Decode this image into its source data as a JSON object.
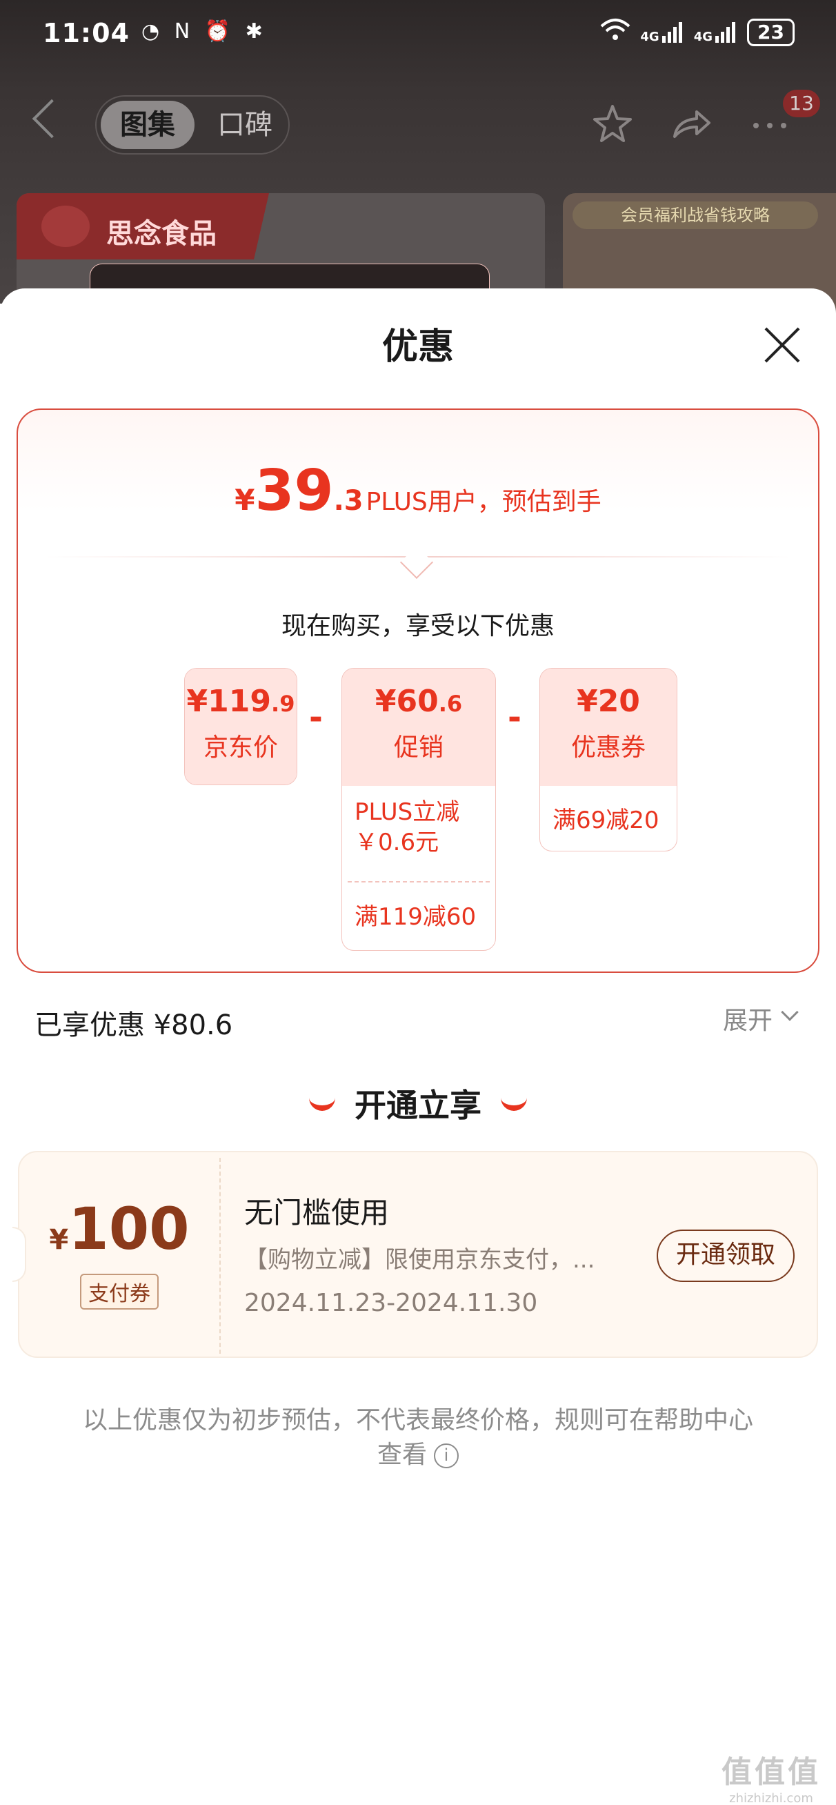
{
  "status_bar": {
    "time": "11:04",
    "left_icons": "◔ N ⏰ ✱",
    "signal": "4G",
    "signal2": "4G",
    "battery": "23"
  },
  "nav": {
    "tab_gallery": "图集",
    "tab_reviews": "口碑",
    "badge_count": "13"
  },
  "background": {
    "brand_text": "思念食品",
    "banner_text": "会员福利战省钱攻略"
  },
  "sheet": {
    "title": "优惠",
    "estimate": {
      "yen": "¥",
      "integer": "39",
      "decimal": ".3",
      "label": "PLUS用户，预估到手"
    },
    "subtitle": "现在购买，享受以下优惠",
    "boxes": [
      {
        "yen": "¥",
        "amount": "119",
        "decimal": ".9",
        "label": "京东价",
        "details": []
      },
      {
        "yen": "¥",
        "amount": "60",
        "decimal": ".6",
        "label": "促销",
        "details": [
          "PLUS立减\n￥0.6元",
          "满119减60"
        ]
      },
      {
        "yen": "¥",
        "amount": "20",
        "decimal": "",
        "label": "优惠券",
        "details": [
          "满69减20"
        ]
      }
    ],
    "operator": "-",
    "saved": "已享优惠 ¥80.6",
    "expand": "展开",
    "section_title": "开通立享",
    "coupon": {
      "yen": "¥",
      "amount": "100",
      "tag": "支付券",
      "title": "无门槛使用",
      "desc": "【购物立减】限使用京东支付，...",
      "date": "2024.11.23-2024.11.30",
      "button": "开通领取"
    },
    "footnote": "以上优惠仅为初步预估，不代表最终价格，规则可在帮助中心查看"
  },
  "watermark": {
    "big": "值值值",
    "small": "zhizhizhi.com"
  },
  "colors": {
    "accent": "#e8341f",
    "coupon_brown": "#8b3a1a"
  }
}
